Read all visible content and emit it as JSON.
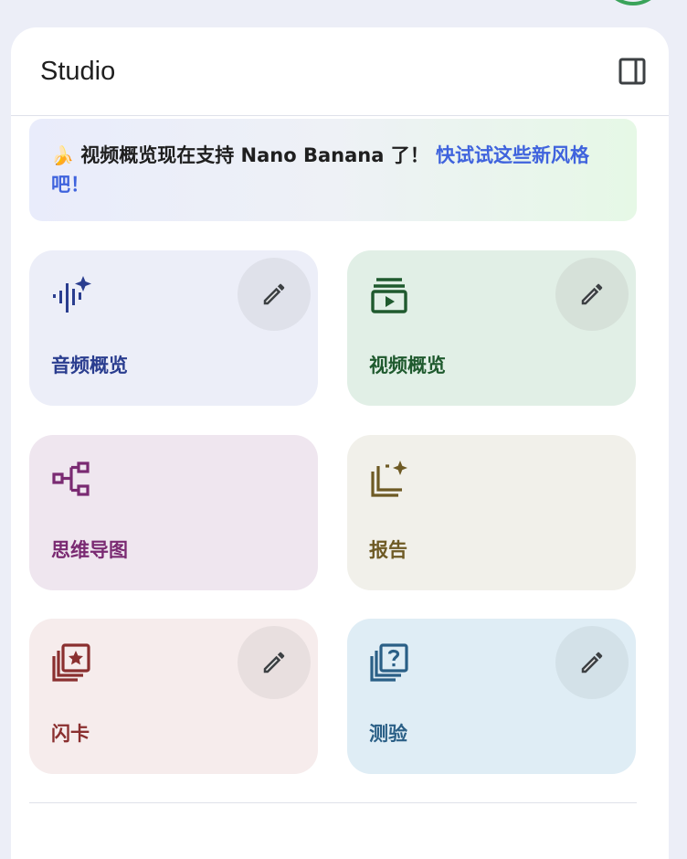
{
  "panel": {
    "title": "Studio",
    "toggle_icon": "side-panel-icon"
  },
  "banner": {
    "emoji": "🍌",
    "text": " 视频概览现在支持 Nano Banana 了！ ",
    "link": "快试试这些新风格吧！"
  },
  "cards": {
    "audio": {
      "label": "音频概览",
      "icon": "audio-sparkle-icon",
      "color": "#2a3d8f",
      "has_edit": true
    },
    "video": {
      "label": "视频概览",
      "icon": "video-play-icon",
      "color": "#1f5a2e",
      "has_edit": true
    },
    "mind": {
      "label": "思维导图",
      "icon": "mind-map-icon",
      "color": "#7a2a72",
      "has_edit": false
    },
    "report": {
      "label": "报告",
      "icon": "report-sparkle-icon",
      "color": "#6e5a24",
      "has_edit": false
    },
    "flash": {
      "label": "闪卡",
      "icon": "flashcard-star-icon",
      "color": "#8a2f2f",
      "has_edit": true
    },
    "quiz": {
      "label": "测验",
      "icon": "quiz-question-icon",
      "color": "#2a5f86",
      "has_edit": true
    }
  },
  "edit_icon": "pencil-icon"
}
